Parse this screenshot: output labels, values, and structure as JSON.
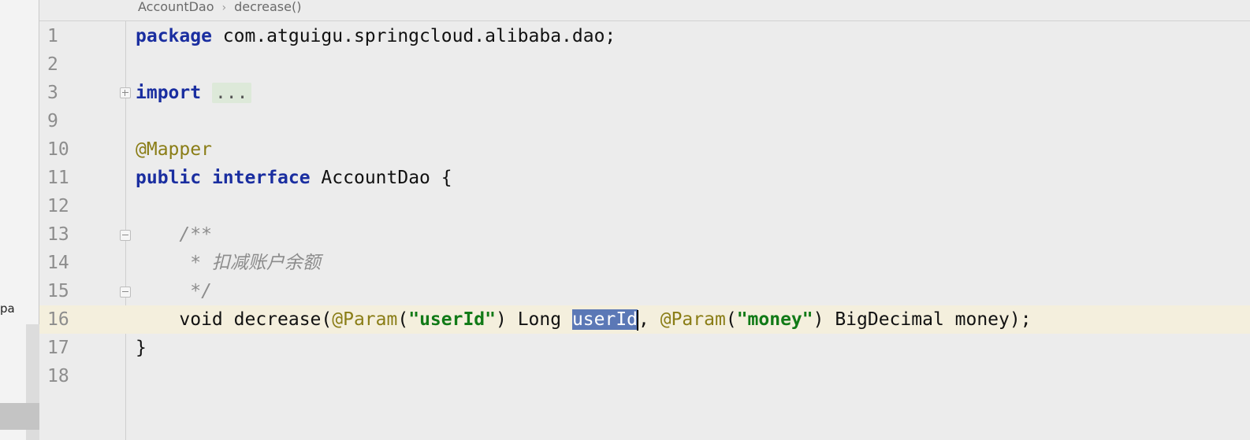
{
  "left_panel": {
    "stub_text": "pa"
  },
  "breadcrumb": {
    "items": [
      "AccountDao",
      "decrease()"
    ],
    "separator": "›"
  },
  "editor": {
    "line_numbers": [
      "1",
      "2",
      "3",
      "9",
      "10",
      "11",
      "12",
      "13",
      "14",
      "15",
      "16",
      "17",
      "18"
    ],
    "code": {
      "l1_kw": "package",
      "l1_rest": " com.atguigu.springcloud.alibaba.dao;",
      "l3_kw": "import",
      "l3_fold": "...",
      "l10_anno": "@Mapper",
      "l11_kw1": "public",
      "l11_kw2": "interface",
      "l11_rest": " AccountDao {",
      "l13": "    /**",
      "l14": "     * 扣减账户余额",
      "l15": "     */",
      "l16_indent": "    ",
      "l16_kw": "void",
      "l16_a": " decrease(",
      "l16_anno1": "@Param",
      "l16_b": "(",
      "l16_str1": "\"userId\"",
      "l16_c": ") Long ",
      "l16_sel": "userId",
      "l16_d": ", ",
      "l16_anno2": "@Param",
      "l16_e": "(",
      "l16_str2": "\"money\"",
      "l16_f": ") BigDecimal money);",
      "l17": "}"
    }
  },
  "colors": {
    "keyword": "#1a2ea0",
    "annotation": "#8a7d16",
    "string": "#117a17",
    "comment": "#8c8c8c",
    "current_line": "#f4efdd",
    "selection": "#5b78b6"
  }
}
